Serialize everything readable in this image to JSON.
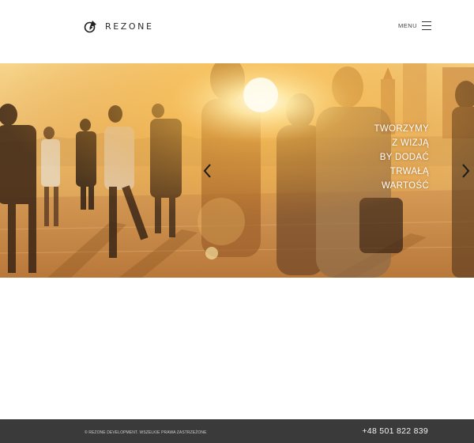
{
  "header": {
    "brand": "REZONE",
    "menu_label": "MENU"
  },
  "hero": {
    "caption_lines": [
      "TWORZYMY",
      "Z WIZJĄ",
      "BY DODAĆ",
      "TRWAŁĄ",
      "WARTOŚĆ"
    ]
  },
  "footer": {
    "copyright": "© REZONE DEVELOPMENT. WSZELKIE PRAWA ZASTRZEŻONE",
    "phone": "+48 501 822 839",
    "background": "#3a3a3a"
  },
  "icons": {
    "logo": "rezone-logo-icon",
    "menu": "hamburger-menu-icon",
    "prev": "chevron-left-icon",
    "next": "chevron-right-icon"
  }
}
